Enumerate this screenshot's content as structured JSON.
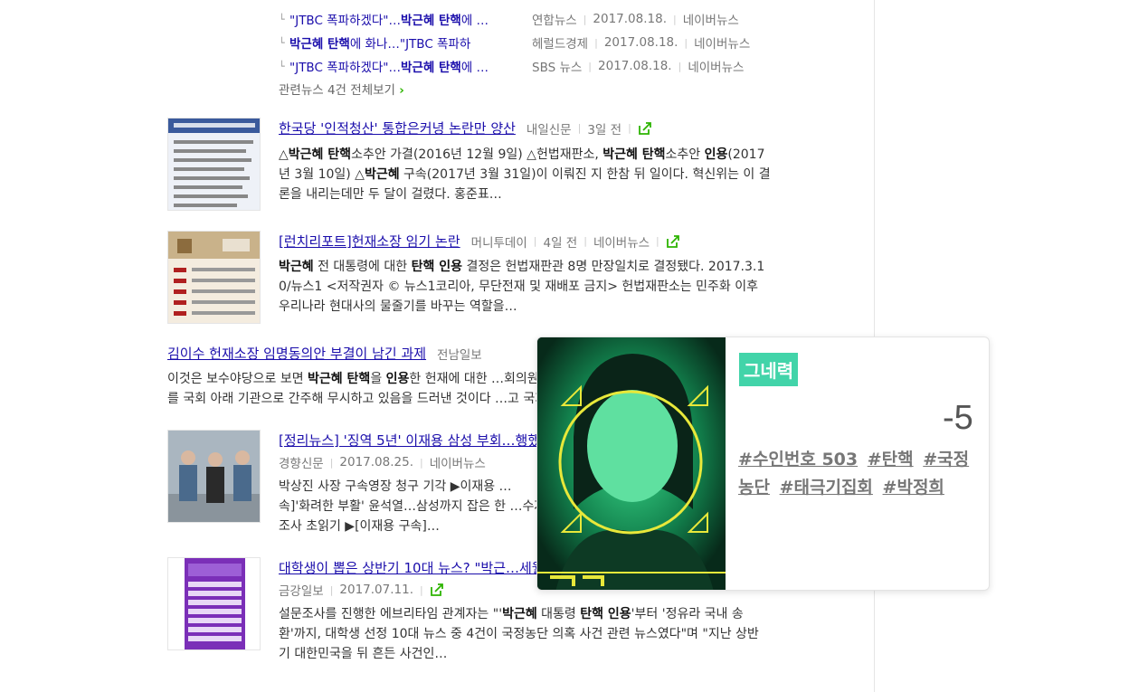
{
  "related_news": [
    {
      "title_pre": "\"JTBC 폭파하겠다\"…",
      "title_bold": "박근혜 탄핵",
      "title_post": "에 …",
      "source": "연합뉴스",
      "date": "2017.08.18.",
      "portal": "네이버뉴스"
    },
    {
      "title_pre": "",
      "title_bold": "박근혜 탄핵",
      "title_post": "에 화나…\"JTBC 폭파하",
      "source": "헤럴드경제",
      "date": "2017.08.18.",
      "portal": "네이버뉴스"
    },
    {
      "title_pre": "\"JTBC 폭파하겠다\"…",
      "title_bold": "박근혜 탄핵",
      "title_post": "에 …",
      "source": "SBS 뉴스",
      "date": "2017.08.18.",
      "portal": "네이버뉴스"
    }
  ],
  "more_related": "관련뉴스 4건 전체보기",
  "articles": [
    {
      "title": "한국당 '인적청산' 통합은커녕 논란만 양산",
      "source": "내일신문",
      "date": "3일 전",
      "desc_lines": [
        [
          [
            "△",
            ""
          ],
          [
            "박근혜 탄핵",
            "b"
          ],
          [
            "소추안 가결(2016년 12월 9일) △헌법재판소, ",
            ""
          ],
          [
            "박근혜 탄핵",
            "b"
          ],
          [
            "소추안 ",
            ""
          ],
          [
            "인용",
            "b"
          ],
          [
            "(2017",
            ""
          ]
        ],
        [
          [
            "년 3월 10일) △",
            ""
          ],
          [
            "박근혜",
            "b"
          ],
          [
            " 구속(2017년 3월 31일)이 이뤄진 지 한참 뒤 일이다. 혁신위는 이 결",
            ""
          ]
        ],
        [
          [
            "론을 내리는데만 두 달이 걸렸다. 홍준표…",
            ""
          ]
        ]
      ]
    },
    {
      "title": "[런치리포트]헌재소장 임기 논란",
      "source": "머니투데이",
      "date": "4일 전",
      "portal": "네이버뉴스",
      "desc_lines": [
        [
          [
            "박근혜",
            "b"
          ],
          [
            " 전 대통령에 대한 ",
            ""
          ],
          [
            "탄핵 인용",
            "b"
          ],
          [
            " 결정은 헌법재판관 8명 만장일치로 결정됐다. 2017.3.1",
            ""
          ]
        ],
        [
          [
            "0/뉴스1 <저작권자 © 뉴스1코리아, 무단전재 및 재배포 금지> 헌법재판소는 민주화 이후",
            ""
          ]
        ],
        [
          [
            "우리나라 현대사의 물줄기를 바꾸는 역할을…",
            ""
          ]
        ]
      ]
    },
    {
      "title": "김이수 헌재소장 임명동의안 부결이 남긴 과제",
      "source": "전남일보",
      "desc_lines": [
        [
          [
            "이것은 보수야당으로 보면 ",
            ""
          ],
          [
            "박근혜 탄핵",
            "b"
          ],
          [
            "을 ",
            ""
          ],
          [
            "인용",
            "b"
          ],
          [
            "한 헌재에 대한 …회의원들이 헌재",
            ""
          ]
        ],
        [
          [
            "를 국회 아래 기관으로 간주해 무시하고 있음을 드러낸 것이다 …고 국회가…",
            ""
          ]
        ]
      ]
    },
    {
      "title": "[정리뉴스] '징역 5년' 이재용 삼성 부회…행했나",
      "source": "경향신문",
      "date": "2017.08.25.",
      "portal": "네이버뉴스",
      "desc_lines": [
        [
          [
            "박상진 사장 구속영장 청구 기각 ▶이재용 …",
            ""
          ]
        ],
        [
          [
            "속]'화려한 부활' 윤석열…삼성까지 잡은 한 …수자 박근혜' 대면",
            ""
          ]
        ],
        [
          [
            "조사 초읽기 ▶[이재용 구속]…",
            ""
          ]
        ]
      ]
    },
    {
      "title": "대학생이 뽑은 상반기 10대 뉴스? \"박근…세월호 …",
      "source": "금강일보",
      "date": "2017.07.11.",
      "desc_lines": [
        [
          [
            "설문조사를 진행한 에브리타임 관계자는 \"'",
            ""
          ],
          [
            "박근혜",
            "b"
          ],
          [
            " 대통령 ",
            ""
          ],
          [
            "탄핵 인용",
            "b"
          ],
          [
            "'부터 '정유라 국내 송",
            ""
          ]
        ],
        [
          [
            "환'까지, 대학생 선정 10대 뉴스 중 4건이 국정농단 의혹 사건 관련 뉴스였다\"며 \"지난 상반",
            ""
          ]
        ],
        [
          [
            "기 대한민국을 뒤 흔든 사건인…",
            ""
          ]
        ]
      ]
    }
  ],
  "popup": {
    "badge": "그네력",
    "score": "-5",
    "tags": [
      "#수인번호 503",
      "#탄핵",
      "#국정농단",
      "#태극기집회",
      "#박정희"
    ]
  }
}
